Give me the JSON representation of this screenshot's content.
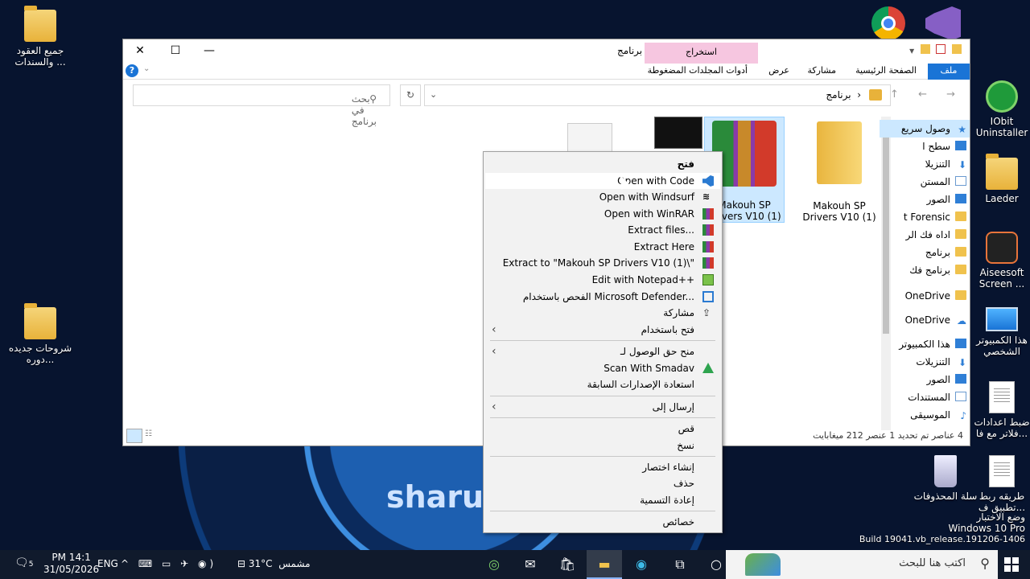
{
  "desktop": {
    "left_icons": [
      {
        "label": "جميع العقود والسندات ..."
      },
      {
        "label": "شروحات جديده دوره..."
      }
    ],
    "right_icons": [
      {
        "label": "IObit Uninstaller"
      },
      {
        "label": "Laeder"
      },
      {
        "label": "Aiseesoft Screen ..."
      },
      {
        "label": "هذا الكمبيوتر الشخصي"
      },
      {
        "label": "ضبط اعدادات فلاتر مع فا..."
      },
      {
        "label": "طريقه ربط تطبيق ف..."
      }
    ],
    "recycle_bin": "سلة المحذوفات",
    "watermark_text": "sharua"
  },
  "explorer": {
    "title": "برنامج",
    "extract_tab": "استخراج",
    "compressed_tools": "أدوات المجلدات المضغوطة",
    "ribbon_tabs": {
      "file": "ملف",
      "home": "الصفحة الرئيسية",
      "share": "مشاركة",
      "view": "عرض"
    },
    "address_path": "برنامج",
    "search_placeholder": "بحث في برنامج",
    "files": [
      {
        "name": "Makouh SP Drivers V10 (1)"
      },
      {
        "name": "Makouh SP Drivers V10 (1)"
      }
    ],
    "nav_items": [
      {
        "label": "وصول سريع"
      },
      {
        "label": "سطح ا"
      },
      {
        "label": "التنزيلا"
      },
      {
        "label": "المستن"
      },
      {
        "label": "الصور"
      },
      {
        "label": "t Forensic"
      },
      {
        "label": "اداه فك الر"
      },
      {
        "label": "برنامج"
      },
      {
        "label": "برنامج فك"
      },
      {
        "label": "OneDrive"
      },
      {
        "label": "OneDrive"
      },
      {
        "label": "هذا الكمبيوتر"
      },
      {
        "label": "التنزيلات"
      },
      {
        "label": "الصور"
      },
      {
        "label": "المستندات"
      },
      {
        "label": "الموسيقى"
      }
    ],
    "status": "4 عناصر    تم تحديد 1 عنصر  212 ميغابايت"
  },
  "context_menu": {
    "items": [
      {
        "label": "فتح",
        "bold": true
      },
      {
        "label": "Open with Code"
      },
      {
        "label": "Open with Windsurf"
      },
      {
        "label": "Open with WinRAR"
      },
      {
        "label": "Extract files..."
      },
      {
        "label": "Extract Here"
      },
      {
        "label": "Extract to \"Makouh SP Drivers V10 (1)\\\""
      },
      {
        "label": "Edit with Notepad++"
      },
      {
        "label": "الفحص باستخدام Microsoft Defender..."
      },
      {
        "label": "مشاركة"
      },
      {
        "label": "فتح باستخدام"
      },
      {
        "label": "منح حق الوصول لـ"
      },
      {
        "label": "Scan With Smadav"
      },
      {
        "label": "استعادة الإصدارات السابقة"
      },
      {
        "label": "إرسال إلى"
      },
      {
        "label": "قص"
      },
      {
        "label": "نسخ"
      },
      {
        "label": "إنشاء اختصار"
      },
      {
        "label": "حذف"
      },
      {
        "label": "إعادة التسمية"
      },
      {
        "label": "خصائص"
      }
    ]
  },
  "watermark": {
    "line1": "وضع الاختبار",
    "line2": "Windows 10 Pro",
    "line3": "Build 19041.vb_release.191206-1406"
  },
  "taskbar": {
    "search_placeholder": "اكتب هنا للبحث",
    "weather": "مشمس",
    "temp": "31°C",
    "lang": "ENG",
    "time": "PM 14:1",
    "date": "31/05/2026",
    "notif_count": "5"
  },
  "colors": {
    "accent": "#1a74d6",
    "extract_tab": "#f6c6e0",
    "taskbar": "#101a2c"
  }
}
